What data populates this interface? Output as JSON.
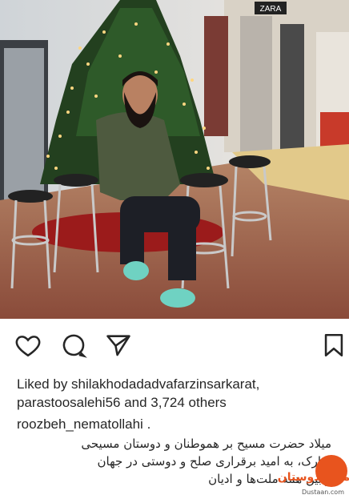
{
  "post": {
    "liked_by_prefix": "Liked by ",
    "liked_by_users": "shilakhodadadvafarzinsarkarat,",
    "liked_by_user2": "parastoosalehi56",
    "likes_and": " and ",
    "likes_count": "3,724 others",
    "author": "roozbeh_nematollahi",
    "author_suffix": " .",
    "caption_line1": "میلاد حضرت مسیح بر هموطنان و دوستان مسیحی",
    "caption_line2": "مبارک، به امید برقراری صلح و دوستی در جهان",
    "caption_line3": "و بین همه ملت‌ها و ادیان"
  },
  "icons": {
    "like": "heart-icon",
    "comment": "comment-icon",
    "share": "send-icon",
    "save": "bookmark-icon"
  },
  "photo_sign": "ZARA",
  "watermark": {
    "logo_text": "مجله دوستان",
    "site": "Dustaan.com"
  },
  "colors": {
    "text": "#262626",
    "background": "#ffffff",
    "watermark": "#e8541e"
  }
}
